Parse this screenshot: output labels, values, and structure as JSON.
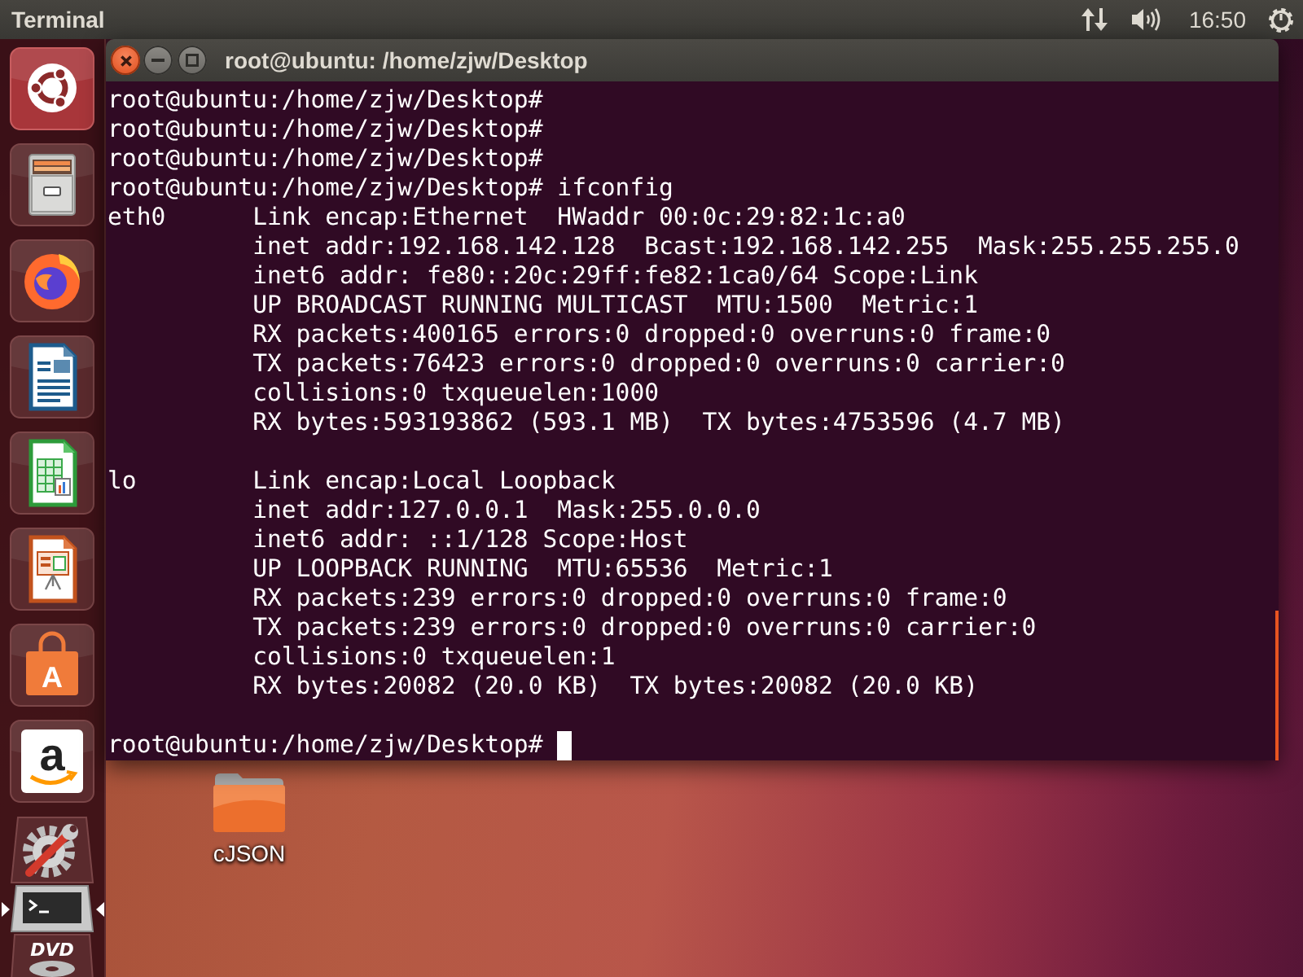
{
  "top_panel": {
    "app_name": "Terminal",
    "clock": "16:50"
  },
  "launcher": {
    "items": [
      {
        "kind": "dash",
        "active": false
      },
      {
        "kind": "files",
        "active": false
      },
      {
        "kind": "browser",
        "active": false
      },
      {
        "kind": "writer",
        "active": false
      },
      {
        "kind": "calc",
        "active": false
      },
      {
        "kind": "impress",
        "active": false
      },
      {
        "kind": "software",
        "glyph": "A",
        "active": false
      },
      {
        "kind": "store",
        "glyph": "a",
        "active": false
      },
      {
        "kind": "settings",
        "active": false
      },
      {
        "kind": "terminal",
        "active": true
      },
      {
        "kind": "dvd",
        "glyph": "DVD",
        "active": false
      }
    ]
  },
  "terminal": {
    "title": "root@ubuntu: /home/zjw/Desktop",
    "history": [
      "root@ubuntu:/home/zjw/Desktop#",
      "root@ubuntu:/home/zjw/Desktop#",
      "root@ubuntu:/home/zjw/Desktop#",
      "root@ubuntu:/home/zjw/Desktop# ifconfig"
    ],
    "interfaces": [
      {
        "name": "eth0",
        "lines": [
          "Link encap:Ethernet  HWaddr 00:0c:29:82:1c:a0",
          "inet addr:192.168.142.128  Bcast:192.168.142.255  Mask:255.255.255.0",
          "inet6 addr: fe80::20c:29ff:fe82:1ca0/64 Scope:Link",
          "UP BROADCAST RUNNING MULTICAST  MTU:1500  Metric:1",
          "RX packets:400165 errors:0 dropped:0 overruns:0 frame:0",
          "TX packets:76423 errors:0 dropped:0 overruns:0 carrier:0",
          "collisions:0 txqueuelen:1000",
          "RX bytes:593193862 (593.1 MB)  TX bytes:4753596 (4.7 MB)"
        ]
      },
      {
        "name": "lo",
        "lines": [
          "Link encap:Local Loopback",
          "inet addr:127.0.0.1  Mask:255.0.0.0",
          "inet6 addr: ::1/128 Scope:Host",
          "UP LOOPBACK RUNNING  MTU:65536  Metric:1",
          "RX packets:239 errors:0 dropped:0 overruns:0 frame:0",
          "TX packets:239 errors:0 dropped:0 overruns:0 carrier:0",
          "collisions:0 txqueuelen:1",
          "RX bytes:20082 (20.0 KB)  TX bytes:20082 (20.0 KB)"
        ]
      }
    ],
    "prompt": "root@ubuntu:/home/zjw/Desktop#"
  },
  "desktop": {
    "icons": [
      {
        "label": "cJSON"
      }
    ]
  }
}
